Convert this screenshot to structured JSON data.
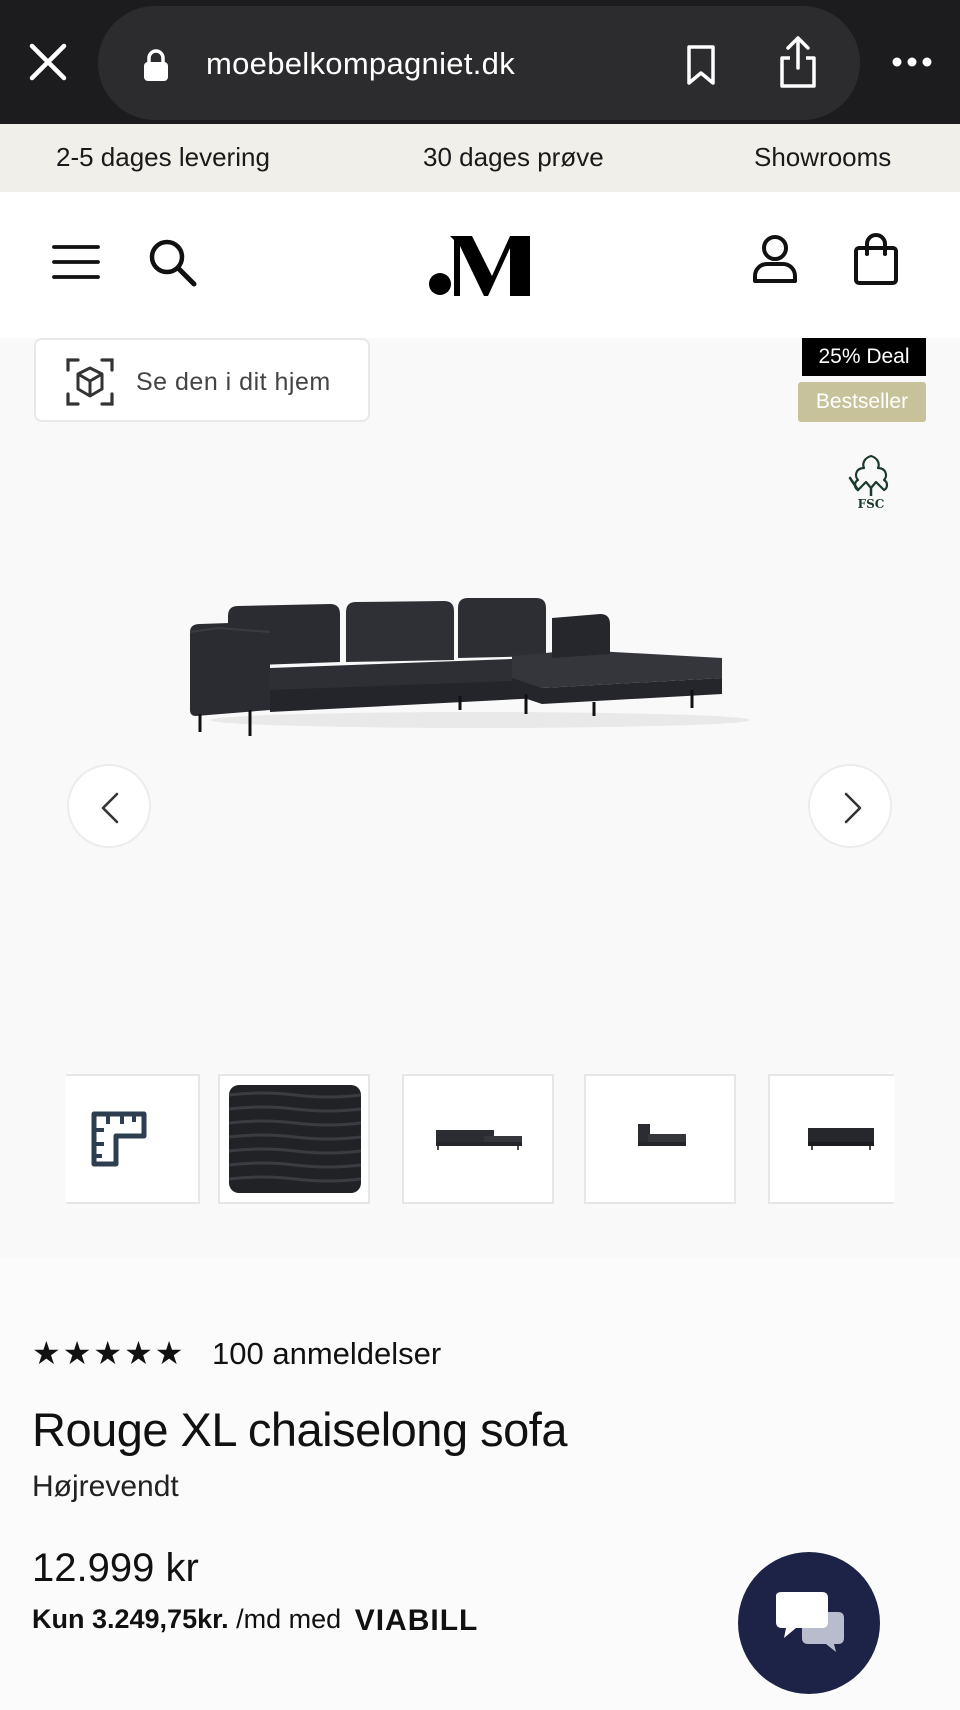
{
  "browser": {
    "url": "moebelkompagniet.dk"
  },
  "usp_bar": {
    "items": [
      "2-5 dages levering",
      "30 dages prøve",
      "Showrooms"
    ]
  },
  "gallery": {
    "ar_button_label": "Se den i dit hjem",
    "badges": [
      "25% Deal",
      "Bestseller"
    ],
    "fsc_label": "FSC"
  },
  "product": {
    "rating_stars": "★★★★★",
    "rating_value": 5,
    "reviews": "100 anmeldelser",
    "title": "Rouge XL chaiselong sofa",
    "variant": "Højrevendt",
    "price": "12.999 kr",
    "financing": {
      "amount": "Kun 3.249,75kr.",
      "suffix": "/md med",
      "provider": "VIABILL"
    }
  },
  "colors": {
    "chrome_bg": "#1c1c1e",
    "usp_bg": "#f1efea",
    "deal_badge": "#000000",
    "bestseller_badge": "#c8c29a",
    "chat_button": "#1d2346"
  }
}
